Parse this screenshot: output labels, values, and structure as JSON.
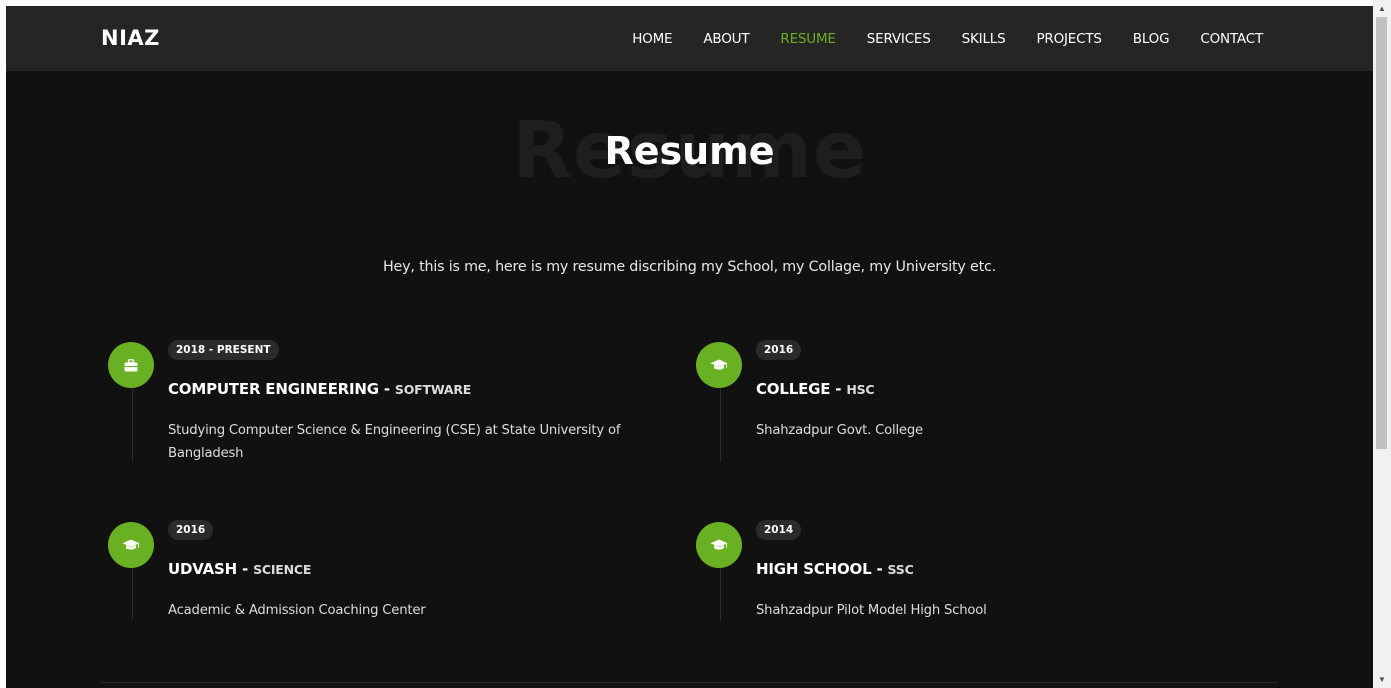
{
  "nav": {
    "brand": "NIAZ",
    "links": [
      {
        "label": "HOME",
        "active": false
      },
      {
        "label": "ABOUT",
        "active": false
      },
      {
        "label": "RESUME",
        "active": true
      },
      {
        "label": "SERVICES",
        "active": false
      },
      {
        "label": "SKILLS",
        "active": false
      },
      {
        "label": "PROJECTS",
        "active": false
      },
      {
        "label": "BLOG",
        "active": false
      },
      {
        "label": "CONTACT",
        "active": false
      }
    ]
  },
  "section": {
    "bg_title": "Resume",
    "title": "Resume",
    "intro": "Hey, this is me, here is my resume discribing my School, my Collage, my University etc."
  },
  "timeline": [
    {
      "icon": "briefcase-icon",
      "date": "2018 - PRESENT",
      "title": "COMPUTER ENGINEERING - ",
      "subtitle": "SOFTWARE",
      "desc": "Studying Computer Science & Engineering (CSE) at State University of Bangladesh"
    },
    {
      "icon": "graduation-cap-icon",
      "date": "2016",
      "title": "COLLEGE - ",
      "subtitle": "HSC",
      "desc": "Shahzadpur Govt. College"
    },
    {
      "icon": "graduation-cap-icon",
      "date": "2016",
      "title": "UDVASH - ",
      "subtitle": "SCIENCE",
      "desc": "Academic & Admission Coaching Center"
    },
    {
      "icon": "graduation-cap-icon",
      "date": "2014",
      "title": "HIGH SCHOOL - ",
      "subtitle": "SSC",
      "desc": "Shahzadpur Pilot Model High School"
    }
  ],
  "colors": {
    "accent": "#6ab023",
    "background": "#111111",
    "navbar": "#252525"
  }
}
